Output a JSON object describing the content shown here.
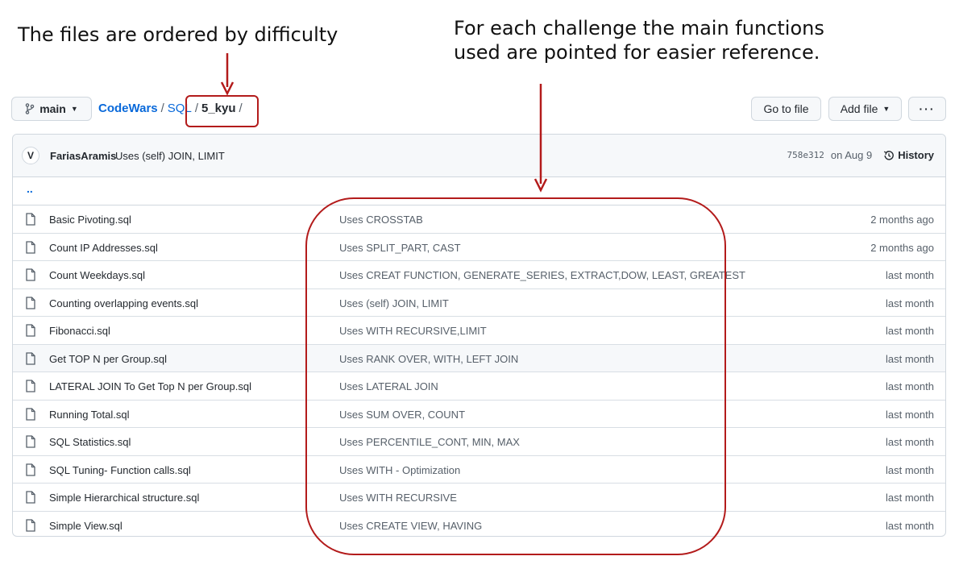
{
  "annotations": {
    "left_note": "The files are ordered by difficulty",
    "right_note_line1": "For each challenge the main functions",
    "right_note_line2": "used are pointed for easier reference.",
    "accent_color": "#b31b1b"
  },
  "toolbar": {
    "branch": "main",
    "goto_file": "Go to file",
    "add_file": "Add file",
    "more": "···"
  },
  "breadcrumb": {
    "repo": "CodeWars",
    "folder": "SQL",
    "current": "5_kyu",
    "sep": "/"
  },
  "commit": {
    "avatar": "V",
    "author": "FariasAramis",
    "message": "Uses (self) JOIN, LIMIT",
    "sha": "758e312",
    "date": "on Aug 9",
    "history": "History"
  },
  "parent_dir": "..",
  "files": [
    {
      "name": "Basic Pivoting.sql",
      "commit": "Uses CROSSTAB",
      "age": "2 months ago"
    },
    {
      "name": "Count IP Addresses.sql",
      "commit": "Uses SPLIT_PART, CAST",
      "age": "2 months ago"
    },
    {
      "name": "Count Weekdays.sql",
      "commit": "Uses CREAT FUNCTION, GENERATE_SERIES, EXTRACT,DOW, LEAST, GREATEST",
      "age": "last month"
    },
    {
      "name": "Counting overlapping events.sql",
      "commit": "Uses (self) JOIN, LIMIT",
      "age": "last month"
    },
    {
      "name": "Fibonacci.sql",
      "commit": "Uses WITH RECURSIVE,LIMIT",
      "age": "last month"
    },
    {
      "name": "Get TOP N per Group.sql",
      "commit": "Uses RANK OVER, WITH, LEFT JOIN",
      "age": "last month"
    },
    {
      "name": "LATERAL JOIN To Get Top N per Group.sql",
      "commit": "Uses LATERAL JOIN",
      "age": "last month"
    },
    {
      "name": "Running Total.sql",
      "commit": "Uses SUM OVER, COUNT",
      "age": "last month"
    },
    {
      "name": "SQL Statistics.sql",
      "commit": "Uses PERCENTILE_CONT, MIN, MAX",
      "age": "last month"
    },
    {
      "name": "SQL Tuning- Function calls.sql",
      "commit": "Uses WITH - Optimization",
      "age": "last month"
    },
    {
      "name": "Simple Hierarchical structure.sql",
      "commit": "Uses WITH RECURSIVE",
      "age": "last month"
    },
    {
      "name": "Simple View.sql",
      "commit": "Uses CREATE VIEW, HAVING",
      "age": "last month"
    }
  ]
}
